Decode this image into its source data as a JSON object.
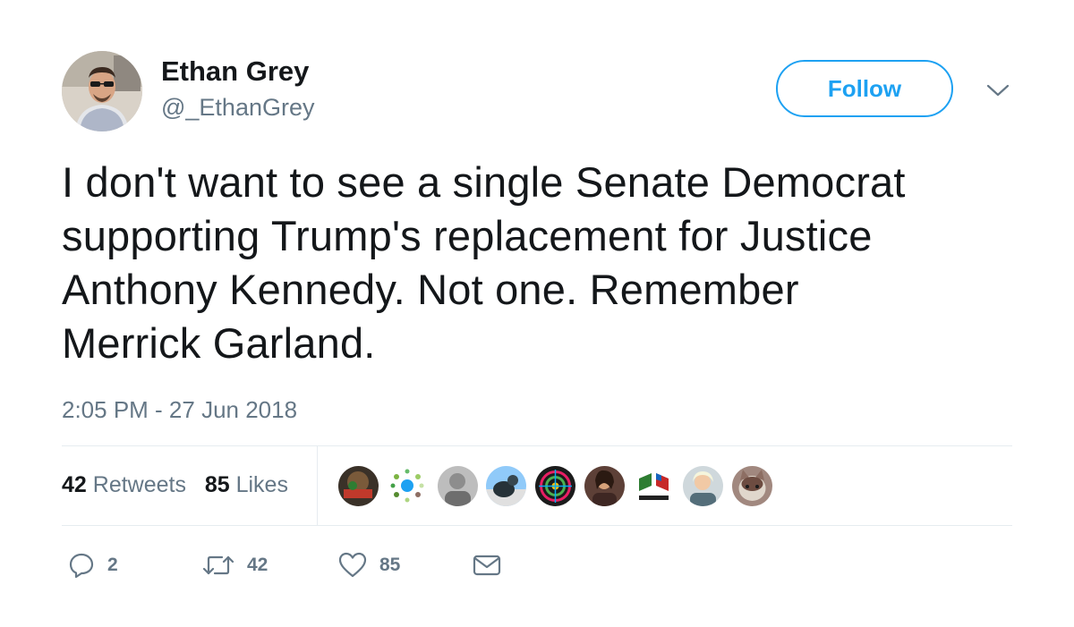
{
  "user": {
    "display_name": "Ethan Grey",
    "handle": "@_EthanGrey"
  },
  "follow_label": "Follow",
  "tweet": {
    "lines": [
      "I don't want to see a single Senate Democrat",
      "supporting Trump's replacement for Justice",
      "Anthony Kennedy. Not one. Remember",
      "Merrick Garland."
    ],
    "timestamp": "2:05 PM - 27 Jun 2018"
  },
  "stats": {
    "retweets_count": "42",
    "retweets_label": "Retweets",
    "likes_count": "85",
    "likes_label": "Likes"
  },
  "actions": {
    "reply_count": "2",
    "retweet_count": "42",
    "like_count": "85"
  },
  "colors": {
    "accent": "#1da1f2",
    "secondary_text": "#657786",
    "primary_text": "#14171a",
    "divider": "#e6ecf0"
  },
  "icons": [
    "chevron-down-icon",
    "reply-icon",
    "retweet-icon",
    "heart-icon",
    "envelope-icon"
  ]
}
